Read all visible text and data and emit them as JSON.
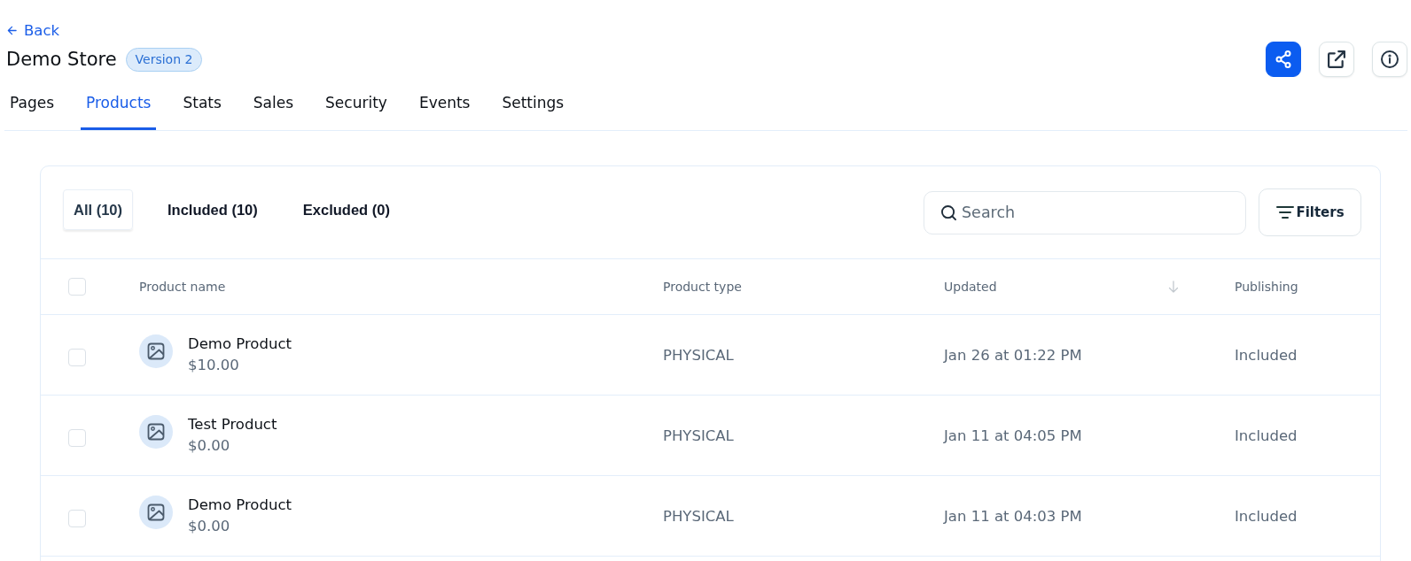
{
  "back_link": {
    "label": "Back"
  },
  "store": {
    "title": "Demo Store",
    "version_badge": "Version 2"
  },
  "header_actions": [
    {
      "kind": "share",
      "primary": true
    },
    {
      "kind": "external-link",
      "primary": false
    },
    {
      "kind": "info",
      "primary": false
    }
  ],
  "nav_tabs": [
    {
      "label": "Pages",
      "selected": false
    },
    {
      "label": "Products",
      "selected": true
    },
    {
      "label": "Stats",
      "selected": false
    },
    {
      "label": "Sales",
      "selected": false
    },
    {
      "label": "Security",
      "selected": false
    },
    {
      "label": "Events",
      "selected": false
    },
    {
      "label": "Settings",
      "selected": false
    }
  ],
  "filter_tabs": [
    {
      "label": "All (10)",
      "selected": true
    },
    {
      "label": "Included (10)",
      "selected": false
    },
    {
      "label": "Excluded (0)",
      "selected": false
    }
  ],
  "search": {
    "placeholder": "Search"
  },
  "filters_button": {
    "label": "Filters"
  },
  "table": {
    "select_all": {
      "checked": false
    },
    "columns": [
      {
        "label": "Product name",
        "sorted": false
      },
      {
        "label": "Product type",
        "sorted": false
      },
      {
        "label": "Updated",
        "sorted": true
      },
      {
        "label": "Publishing",
        "sorted": false
      }
    ],
    "rows": [
      {
        "checked": false,
        "name": "Demo Product",
        "price": "$10.00",
        "type": "PHYSICAL",
        "updated": "Jan 26 at 01:22 PM",
        "publishing": "Included"
      },
      {
        "checked": false,
        "name": "Test Product",
        "price": "$0.00",
        "type": "PHYSICAL",
        "updated": "Jan 11 at 04:05 PM",
        "publishing": "Included"
      },
      {
        "checked": false,
        "name": "Demo Product",
        "price": "$0.00",
        "type": "PHYSICAL",
        "updated": "Jan 11 at 04:03 PM",
        "publishing": "Included"
      }
    ]
  }
}
